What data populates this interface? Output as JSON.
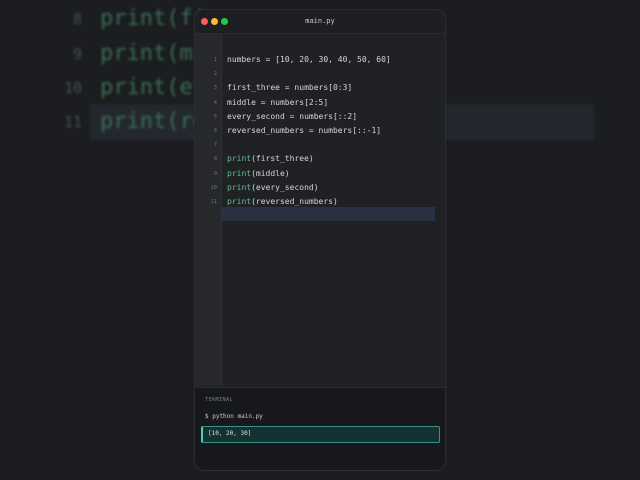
{
  "background": {
    "lines": [
      {
        "num": "8",
        "code": "print(fi"
      },
      {
        "num": "9",
        "code": "print(mid"
      },
      {
        "num": "10",
        "code": "print(eve"
      },
      {
        "num": "11",
        "code": "print(rev"
      }
    ]
  },
  "window": {
    "title": "main.py"
  },
  "editor": {
    "lines": [
      {
        "num": "1",
        "pre": "",
        "kw": "",
        "rest": "numbers = [10, 20, 30, 40, 50, 60]"
      },
      {
        "num": "2",
        "pre": "",
        "kw": "",
        "rest": ""
      },
      {
        "num": "3",
        "pre": "",
        "kw": "",
        "rest": "first_three = numbers[0:3]"
      },
      {
        "num": "4",
        "pre": "",
        "kw": "",
        "rest": "middle = numbers[2:5]"
      },
      {
        "num": "5",
        "pre": "",
        "kw": "",
        "rest": "every_second = numbers[::2]"
      },
      {
        "num": "6",
        "pre": "",
        "kw": "",
        "rest": "reversed_numbers = numbers[::-1]"
      },
      {
        "num": "7",
        "pre": "",
        "kw": "",
        "rest": ""
      },
      {
        "num": "8",
        "pre": "",
        "kw": "print",
        "rest": "(first_three)"
      },
      {
        "num": "9",
        "pre": "",
        "kw": "print",
        "rest": "(middle)"
      },
      {
        "num": "10",
        "pre": "",
        "kw": "print",
        "rest": "(every_second)"
      },
      {
        "num": "11",
        "pre": "",
        "kw": "print",
        "rest": "(reversed_numbers)"
      }
    ],
    "highlighted_line": "11"
  },
  "terminal": {
    "label": "TERMINAL",
    "command": "$ python main.py",
    "output": "[10, 20, 30]"
  },
  "colors": {
    "keyword": "#5ec28a",
    "output_accent": "#4fd1c0"
  }
}
